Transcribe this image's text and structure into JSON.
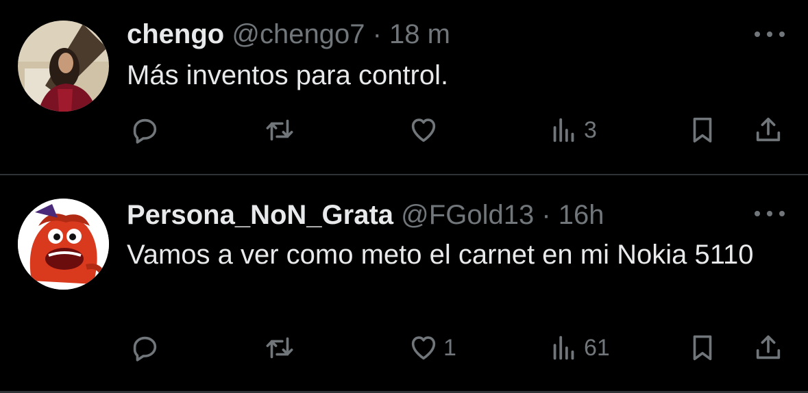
{
  "tweets": [
    {
      "name": "chengo",
      "handle": "@chengo7",
      "separator": "·",
      "time": "18 m",
      "text": "Más inventos para control.",
      "actions": {
        "reply": "",
        "retweet": "",
        "like": "",
        "views": "3"
      }
    },
    {
      "name": "Persona_NoN_Grata",
      "handle": "@FGold13",
      "separator": "·",
      "time": "16h",
      "text": "Vamos a ver como meto el carnet en mi Nokia 5110",
      "actions": {
        "reply": "",
        "retweet": "",
        "like": "1",
        "views": "61"
      }
    }
  ],
  "icons": [
    "reply-icon",
    "retweet-icon",
    "like-icon",
    "views-icon",
    "bookmark-icon",
    "share-icon",
    "more-icon"
  ],
  "colors": {
    "background": "#000000",
    "text": "#e7e9ea",
    "muted": "#71767b",
    "divider": "#2f3336"
  }
}
